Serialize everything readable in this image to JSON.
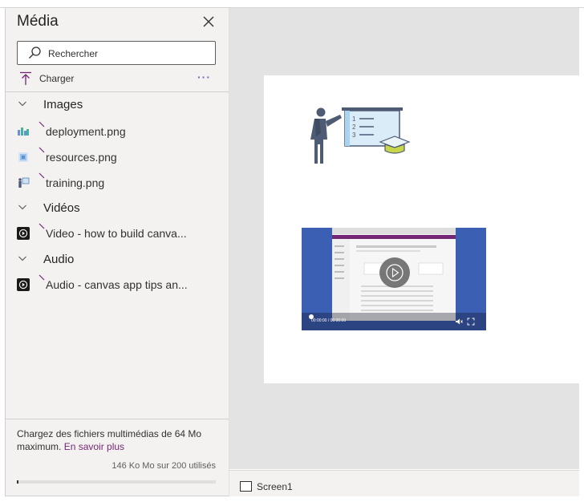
{
  "panel": {
    "title": "Média",
    "search": {
      "placeholder": "Rechercher",
      "value": ""
    },
    "upload_label": "Charger",
    "more_label": "···",
    "sections": {
      "images": {
        "label": "Images",
        "items": [
          {
            "label": "deployment.png",
            "icon": "image-thumbnail-icon"
          },
          {
            "label": "resources.png",
            "icon": "image-thumbnail-icon"
          },
          {
            "label": "training.png",
            "icon": "image-thumbnail-icon"
          }
        ]
      },
      "videos": {
        "label": "Vidéos",
        "items": [
          {
            "label": "Video - how to build canva...",
            "icon": "play-icon"
          }
        ]
      },
      "audio": {
        "label": "Audio",
        "items": [
          {
            "label": "Audio - canvas app tips an...",
            "icon": "play-icon"
          }
        ]
      }
    },
    "footer": {
      "text": "Chargez des fichiers multimédias de 64 Mo maximum.",
      "learn_more": "En savoir plus",
      "usage": "146 Ko Mo sur 200 utilisés",
      "usage_fraction": 0.0007
    }
  },
  "canvas": {
    "video_time": "00:00:00 / 00:00:00"
  },
  "bottom_bar": {
    "screen_label": "Screen1"
  },
  "colors": {
    "accent": "#742774",
    "more_icon": "#8764b8",
    "panel_bg": "#f3f2f1",
    "canvas_bg": "#e3e3e3",
    "video_bg": "#3a5fb3"
  }
}
